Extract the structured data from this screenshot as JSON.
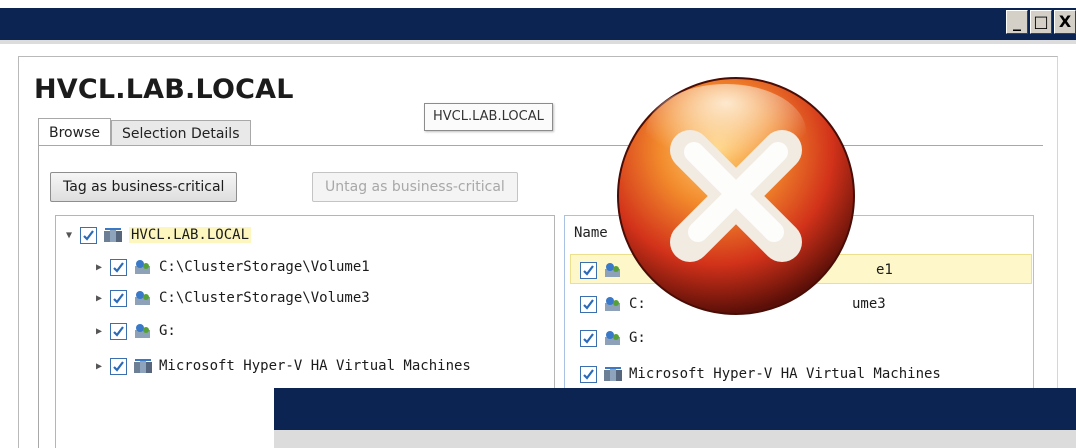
{
  "window": {
    "controls": [
      "_",
      "□",
      "X"
    ]
  },
  "header": {
    "title": "HVCL.LAB.LOCAL",
    "tooltip": "HVCL.LAB.LOCAL"
  },
  "tabs": [
    {
      "label": "Browse",
      "active": true
    },
    {
      "label": "Selection Details",
      "active": false
    }
  ],
  "toolbar": {
    "tag_label": "Tag as business-critical",
    "untag_label": "Untag as business-critical"
  },
  "tree": {
    "root": {
      "label": "HVCL.LAB.LOCAL",
      "checked": true,
      "expanded": true,
      "icon": "cluster-icon"
    },
    "children": [
      {
        "label": "C:\\ClusterStorage\\Volume1",
        "checked": true,
        "icon": "volume-icon"
      },
      {
        "label": "C:\\ClusterStorage\\Volume3",
        "checked": true,
        "icon": "volume-icon"
      },
      {
        "label": "G:",
        "checked": true,
        "icon": "volume-icon"
      },
      {
        "label": "Microsoft Hyper-V HA Virtual Machines",
        "checked": true,
        "icon": "vm-group-icon"
      }
    ]
  },
  "list": {
    "column_header": "Name",
    "rows": [
      {
        "label_left": "",
        "label_right": "e1",
        "checked": true,
        "selected": true,
        "icon": "volume-icon"
      },
      {
        "label_left": "C:",
        "label_right": "ume3",
        "checked": true,
        "icon": "volume-icon"
      },
      {
        "label_left": "G:",
        "label_right": "",
        "checked": true,
        "icon": "volume-icon"
      },
      {
        "label_left": "Microsoft Hyper-V HA Virtual Machines",
        "label_right": "",
        "checked": true,
        "icon": "vm-group-icon"
      }
    ]
  },
  "overlay": {
    "icon": "error-x-icon"
  },
  "colors": {
    "titlebar": "#0b2452",
    "checkbox_border": "#3c6fae",
    "check_mark": "#2a6ab8",
    "highlight": "#fdf6bf",
    "error_red": "#d2321a"
  }
}
